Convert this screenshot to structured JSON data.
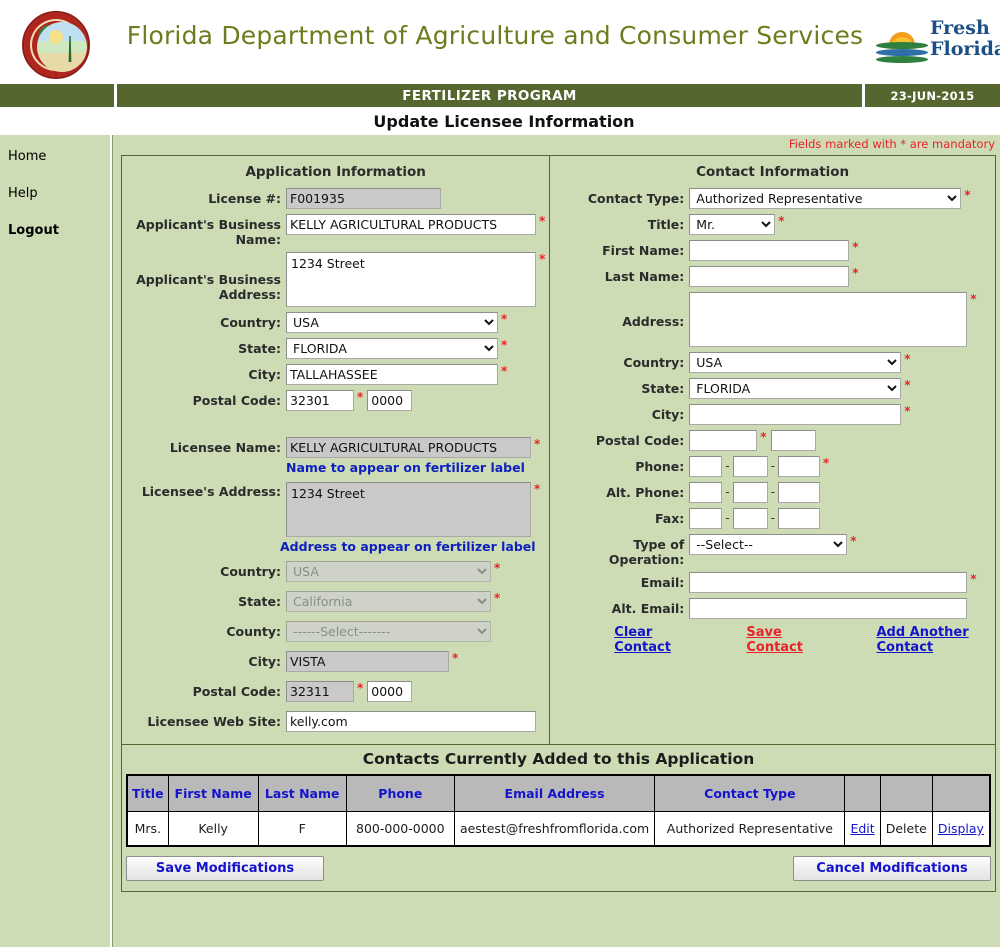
{
  "header": {
    "agency_title": "Florida Department of Agriculture and Consumer Services",
    "program_bar": "FERTILIZER PROGRAM",
    "date": "23-JUN-2015",
    "page_title": "Update Licensee Information",
    "seal_icon": "florida-state-seal-icon",
    "fresh_logo_line1": "Fresh",
    "fresh_logo_line2": "Florida."
  },
  "sidebar": {
    "items": [
      {
        "label": "Home",
        "bold": false
      },
      {
        "label": "Help",
        "bold": false
      },
      {
        "label": "Logout",
        "bold": true
      }
    ]
  },
  "content": {
    "mandatory_note": "Fields marked with * are mandatory"
  },
  "application": {
    "heading": "Application Information",
    "license_label": "License #:",
    "license_value": "F001935",
    "business_name_label": "Applicant's Business Name:",
    "business_name_value": "KELLY AGRICULTURAL PRODUCTS",
    "business_address_label": "Applicant's Business Address:",
    "business_address_value": "1234 Street",
    "country_label": "Country:",
    "country_value": "USA",
    "state_label": "State:",
    "state_value": "FLORIDA",
    "city_label": "City:",
    "city_value": "TALLAHASSEE",
    "postal_label": "Postal Code:",
    "postal_value": "32301",
    "postal_ext_value": "0000",
    "licensee_name_label": "Licensee Name:",
    "licensee_name_value": "KELLY AGRICULTURAL PRODUCTS",
    "licensee_name_note": "Name to appear on fertilizer label",
    "licensee_address_label": "Licensee's Address:",
    "licensee_address_value": "1234 Street",
    "licensee_address_note": "Address to appear on fertilizer label",
    "lic_country_label": "Country:",
    "lic_country_value": "USA",
    "lic_state_label": "State:",
    "lic_state_value": "California",
    "lic_county_label": "County:",
    "lic_county_value": "------Select-------",
    "lic_city_label": "City:",
    "lic_city_value": "VISTA",
    "lic_postal_label": "Postal Code:",
    "lic_postal_value": "32311",
    "lic_postal_ext_value": "0000",
    "website_label": "Licensee Web Site:",
    "website_value": "kelly.com"
  },
  "contact": {
    "heading": "Contact Information",
    "contact_type_label": "Contact Type:",
    "contact_type_value": "Authorized Representative",
    "title_label": "Title:",
    "title_value": "Mr.",
    "first_name_label": "First Name:",
    "first_name_value": "",
    "last_name_label": "Last Name:",
    "last_name_value": "",
    "address_label": "Address:",
    "address_value": "",
    "country_label": "Country:",
    "country_value": "USA",
    "state_label": "State:",
    "state_value": "FLORIDA",
    "city_label": "City:",
    "city_value": "",
    "postal_label": "Postal Code:",
    "postal_value": "",
    "postal_ext_value": "",
    "phone_label": "Phone:",
    "phone_1": "",
    "phone_2": "",
    "phone_3": "",
    "alt_phone_label": "Alt. Phone:",
    "alt_phone_1": "",
    "alt_phone_2": "",
    "alt_phone_3": "",
    "fax_label": "Fax:",
    "fax_1": "",
    "fax_2": "",
    "fax_3": "",
    "type_of_operation_label": "Type of Operation:",
    "type_of_operation_value": "--Select--",
    "email_label": "Email:",
    "email_value": "",
    "alt_email_label": "Alt. Email:",
    "alt_email_value": "",
    "clear_link": "Clear Contact",
    "save_link": "Save Contact",
    "add_link": "Add Another Contact"
  },
  "contacts_table": {
    "title": "Contacts Currently Added to this Application",
    "columns": [
      "Title",
      "First Name",
      "Last Name",
      "Phone",
      "Email Address",
      "Contact Type",
      "",
      "",
      ""
    ],
    "rows": [
      {
        "title": "Mrs.",
        "first_name": "Kelly",
        "last_name": "F",
        "phone": "800-000-0000",
        "email": "aestest@freshfromflorida.com",
        "contact_type": "Authorized Representative",
        "edit": "Edit",
        "delete": "Delete",
        "display": "Display"
      }
    ]
  },
  "footer": {
    "save_label": "Save Modifications",
    "cancel_label": "Cancel Modifications"
  },
  "colors": {
    "page_bg": "#cddcb5",
    "bar_green": "#55662f",
    "title_olive": "#6b7d1e",
    "required_red": "#e8232a",
    "link_blue": "#1414cc"
  }
}
